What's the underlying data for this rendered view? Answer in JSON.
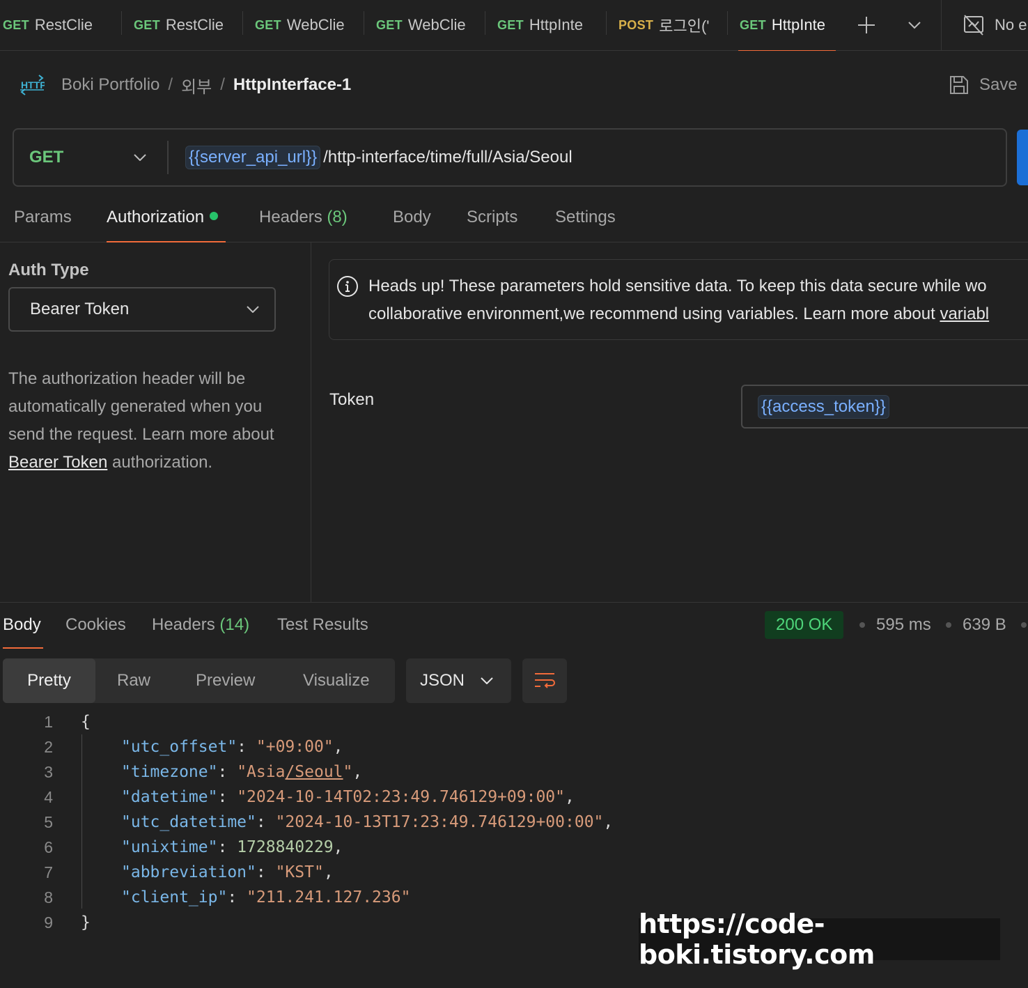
{
  "tabs": [
    {
      "method": "GET",
      "name": "RestClie"
    },
    {
      "method": "GET",
      "name": "RestClie"
    },
    {
      "method": "GET",
      "name": "WebClie"
    },
    {
      "method": "GET",
      "name": "WebClie"
    },
    {
      "method": "GET",
      "name": "HttpInte"
    },
    {
      "method": "POST",
      "name": "로그인('"
    },
    {
      "method": "GET",
      "name": "HttpInte"
    }
  ],
  "environment": {
    "label": "No e"
  },
  "breadcrumb": {
    "icon_text": "HTTP",
    "workspace": "Boki Portfolio",
    "folder": "외부",
    "request": "HttpInterface-1"
  },
  "save_label": "Save",
  "request": {
    "method": "GET",
    "url_variable": "{{server_api_url}}",
    "url_path": "/http-interface/time/full/Asia/Seoul"
  },
  "request_tabs": {
    "params": "Params",
    "authorization": "Authorization",
    "headers": "Headers",
    "headers_count": "(8)",
    "body": "Body",
    "scripts": "Scripts",
    "settings": "Settings"
  },
  "auth": {
    "label": "Auth Type",
    "type": "Bearer Token",
    "desc_text": "The authorization header will be automatically generated when you send the request. Learn more about",
    "desc_link": "Bearer Token",
    "desc_end": "authorization.",
    "notice_line1": "Heads up! These parameters hold sensitive data. To keep this data secure while wo",
    "notice_line2": "collaborative environment,we recommend using variables. Learn more about ",
    "notice_link": "variabl",
    "token_label": "Token",
    "token_value": "{{access_token}}"
  },
  "response_tabs": {
    "body": "Body",
    "cookies": "Cookies",
    "headers": "Headers",
    "headers_count": "(14)",
    "tests": "Test Results"
  },
  "response_meta": {
    "status": "200 OK",
    "time": "595 ms",
    "size": "639 B"
  },
  "view_modes": {
    "pretty": "Pretty",
    "raw": "Raw",
    "preview": "Preview",
    "visualize": "Visualize"
  },
  "format": "JSON",
  "code": {
    "open": "{",
    "close": "}",
    "lines": [
      {
        "n": "1"
      },
      {
        "n": "2"
      },
      {
        "n": "3"
      },
      {
        "n": "4"
      },
      {
        "n": "5"
      },
      {
        "n": "6"
      },
      {
        "n": "7"
      },
      {
        "n": "8"
      },
      {
        "n": "9"
      }
    ],
    "fields": [
      {
        "key": "\"utc_offset\"",
        "value": "\"+09:00\""
      },
      {
        "key": "\"timezone\"",
        "value_pre": "\"Asia",
        "value_link": "/Seoul",
        "value_post": "\""
      },
      {
        "key": "\"datetime\"",
        "value": "\"2024-10-14T02:23:49.746129+09:00\""
      },
      {
        "key": "\"utc_datetime\"",
        "value": "\"2024-10-13T17:23:49.746129+00:00\""
      },
      {
        "key": "\"unixtime\"",
        "value": "1728840229"
      },
      {
        "key": "\"abbreviation\"",
        "value": "\"KST\""
      },
      {
        "key": "\"client_ip\"",
        "value": "\"211.241.127.236\""
      }
    ]
  },
  "watermark": "https://code-boki.tistory.com"
}
